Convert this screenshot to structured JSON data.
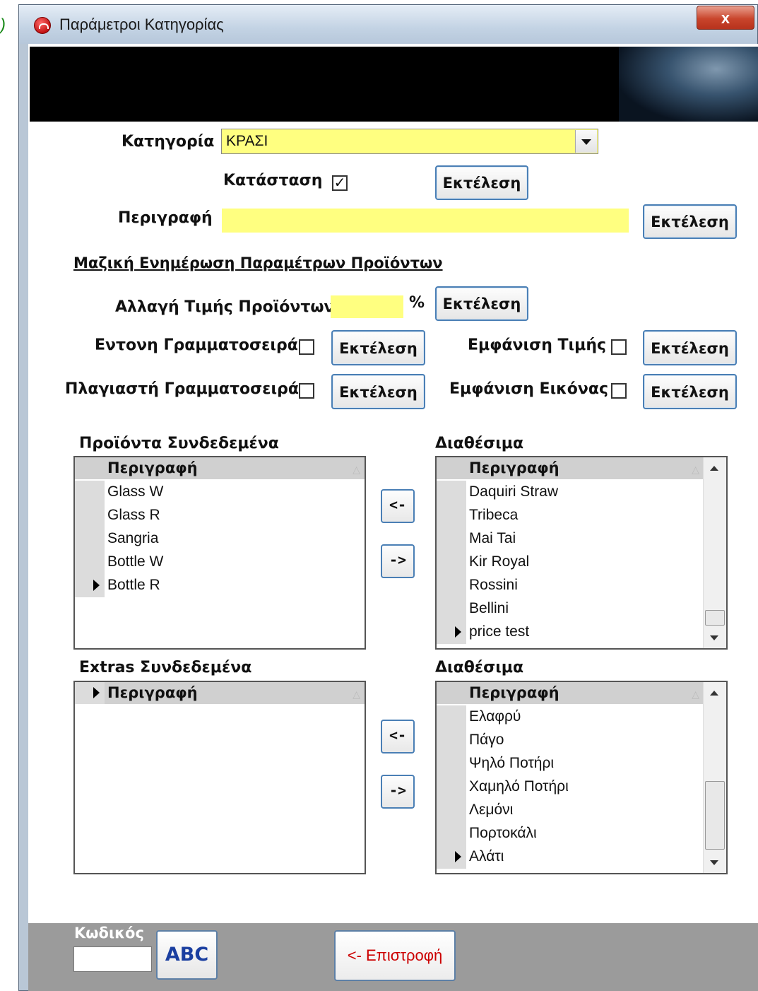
{
  "window": {
    "title": "Παράμετροι Κατηγορίας",
    "close": "x"
  },
  "left_edge_glyph": ")",
  "form": {
    "category_label": "Κατηγορία",
    "category_value": "ΚΡΑΣΙ",
    "status_label": "Κατάσταση",
    "status_checked": "✓",
    "execute": "Εκτέλεση",
    "description_label": "Περιγραφή",
    "description_value": ""
  },
  "bulk": {
    "section_title": "Μαζική Ενημέρωση Παραμέτρων Προϊόντων",
    "price_change_label": "Αλλαγή Τιμής Προϊόντων",
    "price_change_value": "",
    "percent": "%",
    "bold_font_label": "Εντονη Γραμματοσειρά",
    "italic_font_label": "Πλαγιαστή Γραμματοσειρά",
    "show_price_label": "Εμφάνιση Τιμής",
    "show_image_label": "Εμφάνιση Εικόνας"
  },
  "lists": {
    "linked_products_title": "Προϊόντα  Συνδεδεμένα",
    "available_title": "Διαθέσιμα",
    "linked_extras_title": "Extras Συνδεδεμένα",
    "column_header": "Περιγραφή",
    "move_left": "<-",
    "move_right": "->",
    "linked_products": [
      "Glass W",
      "Glass R",
      "Sangria",
      "Bottle W",
      "Bottle R"
    ],
    "available_products": [
      "Daquiri Straw",
      "Tribeca",
      "Mai Tai",
      "Kir Royal",
      "Rossini",
      "Bellini",
      "price test"
    ],
    "linked_extras": [],
    "available_extras": [
      "Ελαφρύ",
      "Πάγο",
      "Ψηλό Ποτήρι",
      "Χαμηλό Ποτήρι",
      "Λεμόνι",
      "Πορτοκάλι",
      "Αλάτι"
    ]
  },
  "footer": {
    "code_label": "Κωδικός",
    "code_value": "",
    "keyboard_button": "ABC",
    "back_button": "<- Επιστροφή"
  },
  "colors": {
    "field_bg": "#ffff80",
    "banner": "#000000",
    "button_border": "#4a7fb5",
    "back_text": "#cc0000"
  }
}
